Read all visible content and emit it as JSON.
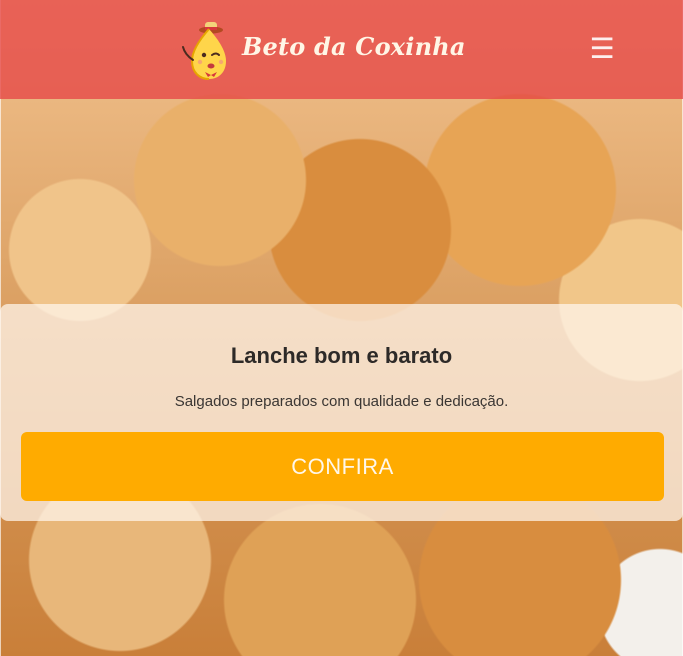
{
  "header": {
    "brand": "Beto da Coxinha",
    "menu_icon": "☰"
  },
  "hero": {
    "headline": "Lanche bom e barato",
    "subtext": "Salgados preparados com qualidade e dedicação.",
    "cta_label": "CONFIRA"
  },
  "colors": {
    "header_bg": "#e64646",
    "cta_bg": "#ffab00",
    "card_bg": "#fff6ee"
  }
}
